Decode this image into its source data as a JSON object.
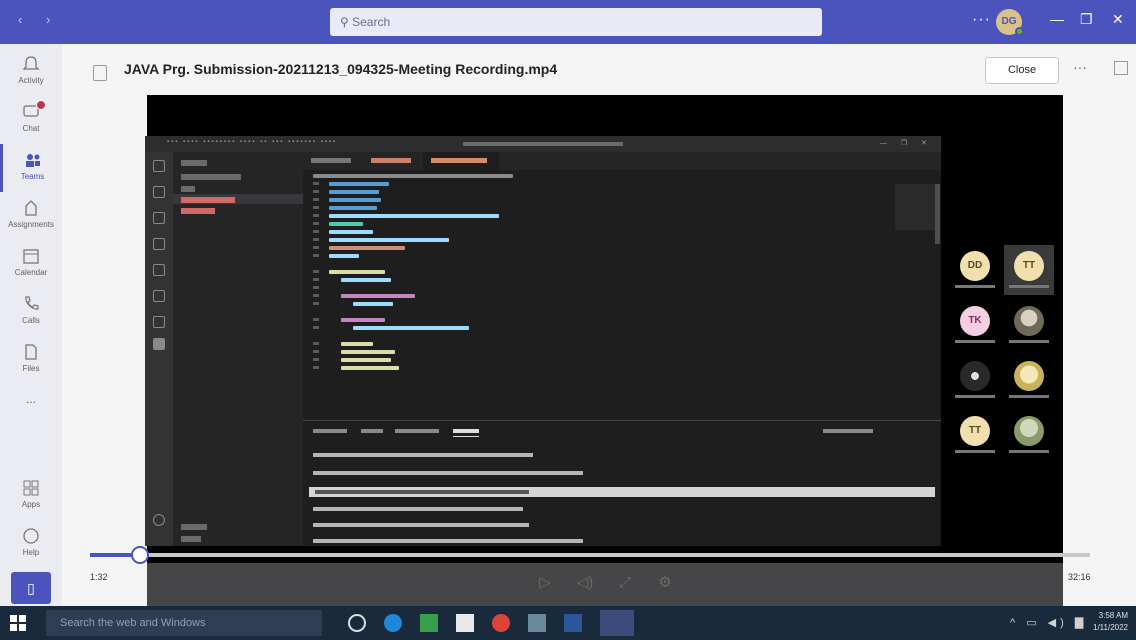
{
  "titlebar": {
    "search_placeholder": "Search",
    "avatar_initials": "DG"
  },
  "rail": {
    "items": [
      {
        "label": "Activity"
      },
      {
        "label": "Chat"
      },
      {
        "label": "Teams"
      },
      {
        "label": "Assignments"
      },
      {
        "label": "Calendar"
      },
      {
        "label": "Calls"
      },
      {
        "label": "Files"
      },
      {
        "label": "..."
      },
      {
        "label": "Apps"
      },
      {
        "label": "Help"
      }
    ]
  },
  "header": {
    "file_title": "JAVA Prg. Submission-20211213_094325-Meeting Recording.mp4",
    "close_label": "Close",
    "more_label": "···"
  },
  "participants": [
    {
      "initials": "DD",
      "bg": "#f2dfae",
      "fg": "#5a4a1a"
    },
    {
      "initials": "TT",
      "bg": "#f2dfae",
      "fg": "#5a4a1a"
    },
    {
      "initials": "TK",
      "bg": "#f4cfe3",
      "fg": "#8a2a5a"
    },
    {
      "initials": "",
      "bg": "#6e6a5a",
      "fg": "#fff"
    },
    {
      "initials": "",
      "bg": "#2a2a2a",
      "fg": "#fff"
    },
    {
      "initials": "",
      "bg": "#c9b05a",
      "fg": "#fff"
    },
    {
      "initials": "TT",
      "bg": "#f2dfae",
      "fg": "#5a4a1a"
    },
    {
      "initials": "",
      "bg": "#8a9a6a",
      "fg": "#fff"
    }
  ],
  "player": {
    "current_time": "1:32",
    "total_time": "32:16",
    "progress": 0.05
  },
  "taskbar": {
    "search_placeholder": "Search the web and Windows",
    "time": "3:58 AM",
    "date": "1/11/2022"
  },
  "colors": {
    "teams_purple": "#4b53bc",
    "taskbar": "#1a2a3d",
    "vscode_bg": "#1e1e1e"
  }
}
